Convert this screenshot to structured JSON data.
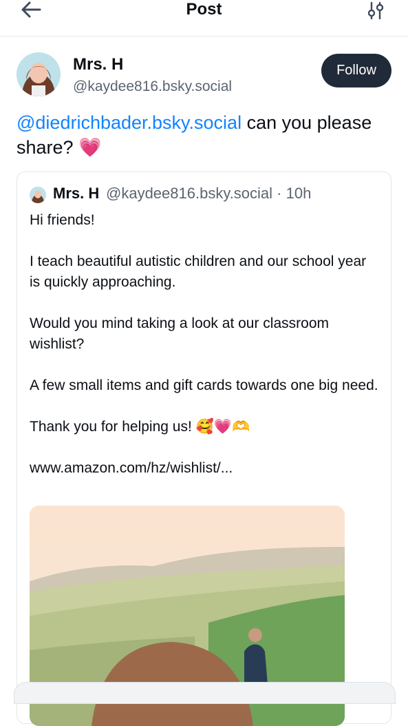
{
  "header": {
    "title": "Post",
    "back_icon": "arrow-left-icon",
    "filter_icon": "sliders-icon"
  },
  "author": {
    "name": "Mrs. H",
    "handle": "@kaydee816.bsky.social",
    "follow_label": "Follow"
  },
  "post": {
    "mention": "@diedrichbader.bsky.social",
    "text": " can you please share? ",
    "emoji": "💗"
  },
  "quote": {
    "name": "Mrs. H",
    "handle_time": "@kaydee816.bsky.social · 10h",
    "paragraphs": [
      "Hi friends!",
      "I teach beautiful autistic children and our school year is quickly approaching.",
      "Would you mind taking a look at our classroom wishlist?",
      "A few small items and gift cards towards one big need.",
      "Thank you for helping us! 🥰💗🫶"
    ],
    "link": "www.amazon.com/hz/wishlist/..."
  },
  "colors": {
    "accent": "#1083fe",
    "follow_bg": "#202a38",
    "muted": "#5b6470"
  }
}
